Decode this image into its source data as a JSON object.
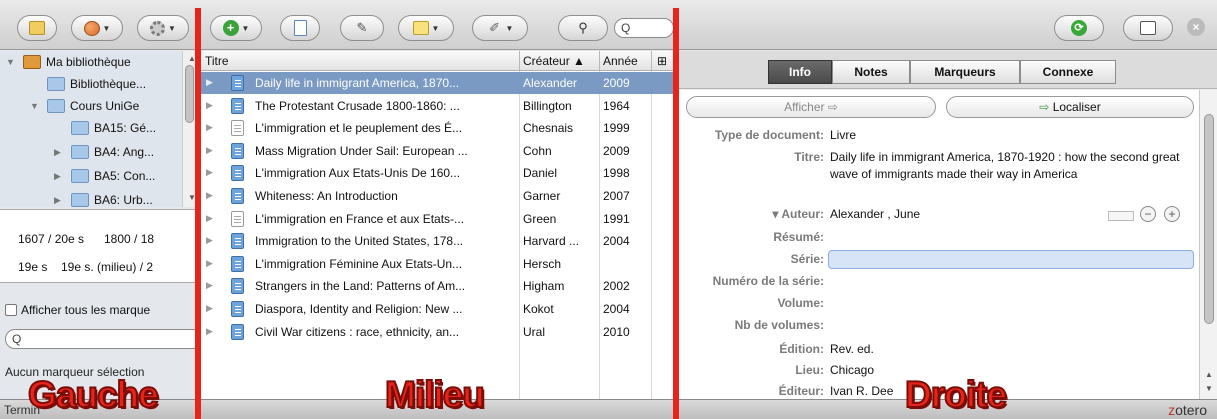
{
  "toolbar": {
    "search_value": "",
    "search_icon": "Q"
  },
  "left": {
    "tree": [
      {
        "label": "Ma bibliothèque",
        "level": 0,
        "icon": "library-icon",
        "expanded": true
      },
      {
        "label": "Bibliothèque...",
        "level": 1,
        "icon": "folder-icon"
      },
      {
        "label": "Cours UniGe",
        "level": 1,
        "icon": "folder-icon",
        "expanded": true
      },
      {
        "label": "BA15: Gé...",
        "level": 2,
        "icon": "folder-icon"
      },
      {
        "label": "BA4: Ang...",
        "level": 2,
        "icon": "folder-icon",
        "collapsed": true
      },
      {
        "label": "BA5: Con...",
        "level": 2,
        "icon": "folder-icon",
        "collapsed": true
      },
      {
        "label": "BA6: Urb...",
        "level": 2,
        "icon": "folder-icon",
        "collapsed": true
      }
    ],
    "tags_line1_a": "1607 / 20e s",
    "tags_line1_b": "1800 / 18",
    "tags_line2_a": "19e s",
    "tags_line2_b": "19e s. (milieu) / 2",
    "show_all_label": "Afficher tous les marque",
    "tag_search_icon": "Q",
    "no_tag_text": "Aucun marqueur sélection"
  },
  "middle": {
    "columns": {
      "title": "Titre",
      "creator": "Créateur ▲",
      "year": "Année",
      "picker": "⊞"
    },
    "items": [
      {
        "title": "Daily life in immigrant America, 1870...",
        "creator": "Alexander",
        "year": "2009",
        "type": "book",
        "selected": true
      },
      {
        "title": "The Protestant Crusade 1800-1860: ...",
        "creator": "Billington",
        "year": "1964",
        "type": "book"
      },
      {
        "title": "L'immigration et le peuplement des É...",
        "creator": "Chesnais",
        "year": "1999",
        "type": "document"
      },
      {
        "title": "Mass Migration Under Sail: European ...",
        "creator": "Cohn",
        "year": "2009",
        "type": "book"
      },
      {
        "title": "L'immigration Aux Etats-Unis De 160...",
        "creator": "Daniel",
        "year": "1998",
        "type": "book"
      },
      {
        "title": "Whiteness: An Introduction",
        "creator": "Garner",
        "year": "2007",
        "type": "book"
      },
      {
        "title": "L'immigration en France et aux Etats-...",
        "creator": "Green",
        "year": "1991",
        "type": "document"
      },
      {
        "title": "Immigration to the United States, 178...",
        "creator": "Harvard ...",
        "year": "2004",
        "type": "book"
      },
      {
        "title": "L'immigration Féminine Aux Etats-Un...",
        "creator": "Hersch",
        "year": "",
        "type": "book"
      },
      {
        "title": "Strangers in the Land: Patterns of Am...",
        "creator": "Higham",
        "year": "2002",
        "type": "book"
      },
      {
        "title": "Diaspora, Identity and Religion: New ...",
        "creator": "Kokot",
        "year": "2004",
        "type": "book"
      },
      {
        "title": "Civil War citizens : race, ethnicity, an...",
        "creator": "Ural",
        "year": "2010",
        "type": "book"
      }
    ]
  },
  "right": {
    "tabs": [
      "Info",
      "Notes",
      "Marqueurs",
      "Connexe"
    ],
    "active_tab": "Info",
    "view_button": "Afficher ⇨",
    "locate_button": "Localiser",
    "locate_arrow": "⇨",
    "fields": {
      "type_label": "Type de document:",
      "type_value": "Livre",
      "title_label": "Titre:",
      "title_value": "Daily life in immigrant America, 1870-1920 : how the second great wave of immigrants made their way in America",
      "author_label": "▾ Auteur:",
      "author_value": "Alexander   ,   June",
      "abstract_label": "Résumé:",
      "series_label": "Série:",
      "series_number_label": "Numéro de la série:",
      "volume_label": "Volume:",
      "num_volumes_label": "Nb de volumes:",
      "edition_label": "Édition:",
      "edition_value": "Rev. ed.",
      "place_label": "Lieu:",
      "place_value": "Chicago",
      "publisher_label": "Éditeur:",
      "publisher_value": "Ivan R. Dee"
    },
    "minus": "−",
    "plus": "+"
  },
  "bottom": {
    "status_left": "Termin",
    "brand_z": "z",
    "brand_rest": "otero"
  },
  "overlay": {
    "left_label": "Gauche",
    "middle_label": "Milieu",
    "right_label": "Droite"
  },
  "colors": {
    "overlay_red": "#e8241a",
    "selection_blue": "#7a9ac4"
  }
}
